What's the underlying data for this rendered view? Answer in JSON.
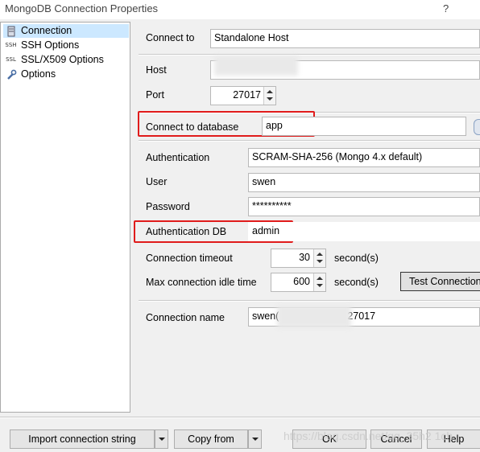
{
  "window": {
    "title": "MongoDB Connection Properties",
    "help_glyph": "?"
  },
  "sidebar": {
    "items": [
      {
        "label": "Connection",
        "icon": "server-icon",
        "selected": true
      },
      {
        "label": "SSH Options",
        "icon_text": "SSH"
      },
      {
        "label": "SSL/X509 Options",
        "icon_text": "SSL"
      },
      {
        "label": "Options",
        "icon": "wrench-icon"
      }
    ]
  },
  "form": {
    "connect_to": {
      "label": "Connect to",
      "value": "Standalone Host"
    },
    "host": {
      "label": "Host",
      "value": ""
    },
    "port": {
      "label": "Port",
      "value": "27017"
    },
    "connect_db": {
      "label": "Connect to database",
      "value": "app"
    },
    "authentication": {
      "label": "Authentication",
      "value": "SCRAM-SHA-256 (Mongo 4.x default)"
    },
    "user": {
      "label": "User",
      "value": "swen"
    },
    "password": {
      "label": "Password",
      "value": "**********"
    },
    "auth_db": {
      "label": "Authentication DB",
      "value": "admin"
    },
    "connection_timeout": {
      "label": "Connection timeout",
      "value": "30",
      "unit": "second(s)"
    },
    "idle_time": {
      "label": "Max connection idle time",
      "value": "600",
      "unit": "second(s)"
    },
    "test_button": "Test Connection",
    "connection_name": {
      "label": "Connection name",
      "prefix": "swen(",
      "suffix": "27017"
    }
  },
  "footer": {
    "import_button": "Import connection string",
    "copy_button": "Copy from",
    "ok_button": "OK",
    "cancel_button": "Cancel",
    "help_button": "Help",
    "watermark": "https://blog.csdn.net/qq_35h2 1ch"
  },
  "colors": {
    "highlight_box": "#e01b1b",
    "selected_item": "#cce8ff"
  }
}
